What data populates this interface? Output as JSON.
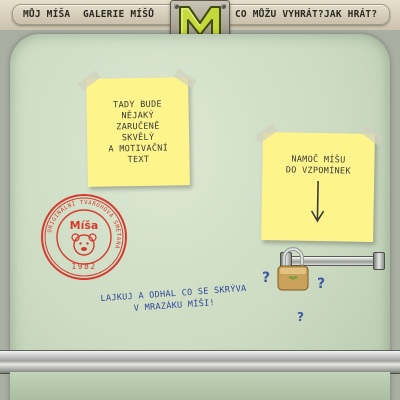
{
  "nav": {
    "items": [
      "MŮJ MÍŠA",
      "GALERIE MÍŠŮ",
      "CO MŮŽU VYHRÁT?",
      "JAK HRÁT?"
    ]
  },
  "notes": {
    "left_lines": [
      "TADY BUDE",
      "NĚJAKÝ",
      "ZARUČENĚ",
      "SKVĚLÝ",
      "A MOTIVAČNÍ",
      "TEXT"
    ],
    "right_lines": [
      "NAMOČ MÍŠU",
      "DO VZPOMÍNEK"
    ]
  },
  "stamp": {
    "ring_text": "ORIGINÁLNÍ TVAROHOVÁ SMETANA",
    "brand": "Míša",
    "year": "1982"
  },
  "caption": {
    "line1": "LAJKUJ A ODHAL CO SE SKRÝVA",
    "line2": "V MRAZÁKU MÍŠI!"
  },
  "colors": {
    "fridge": "#ccdbc2",
    "note": "#fdf48c",
    "stamp": "#d63a2f",
    "logo": "#c4d93a",
    "caption": "#2f4a9a"
  }
}
